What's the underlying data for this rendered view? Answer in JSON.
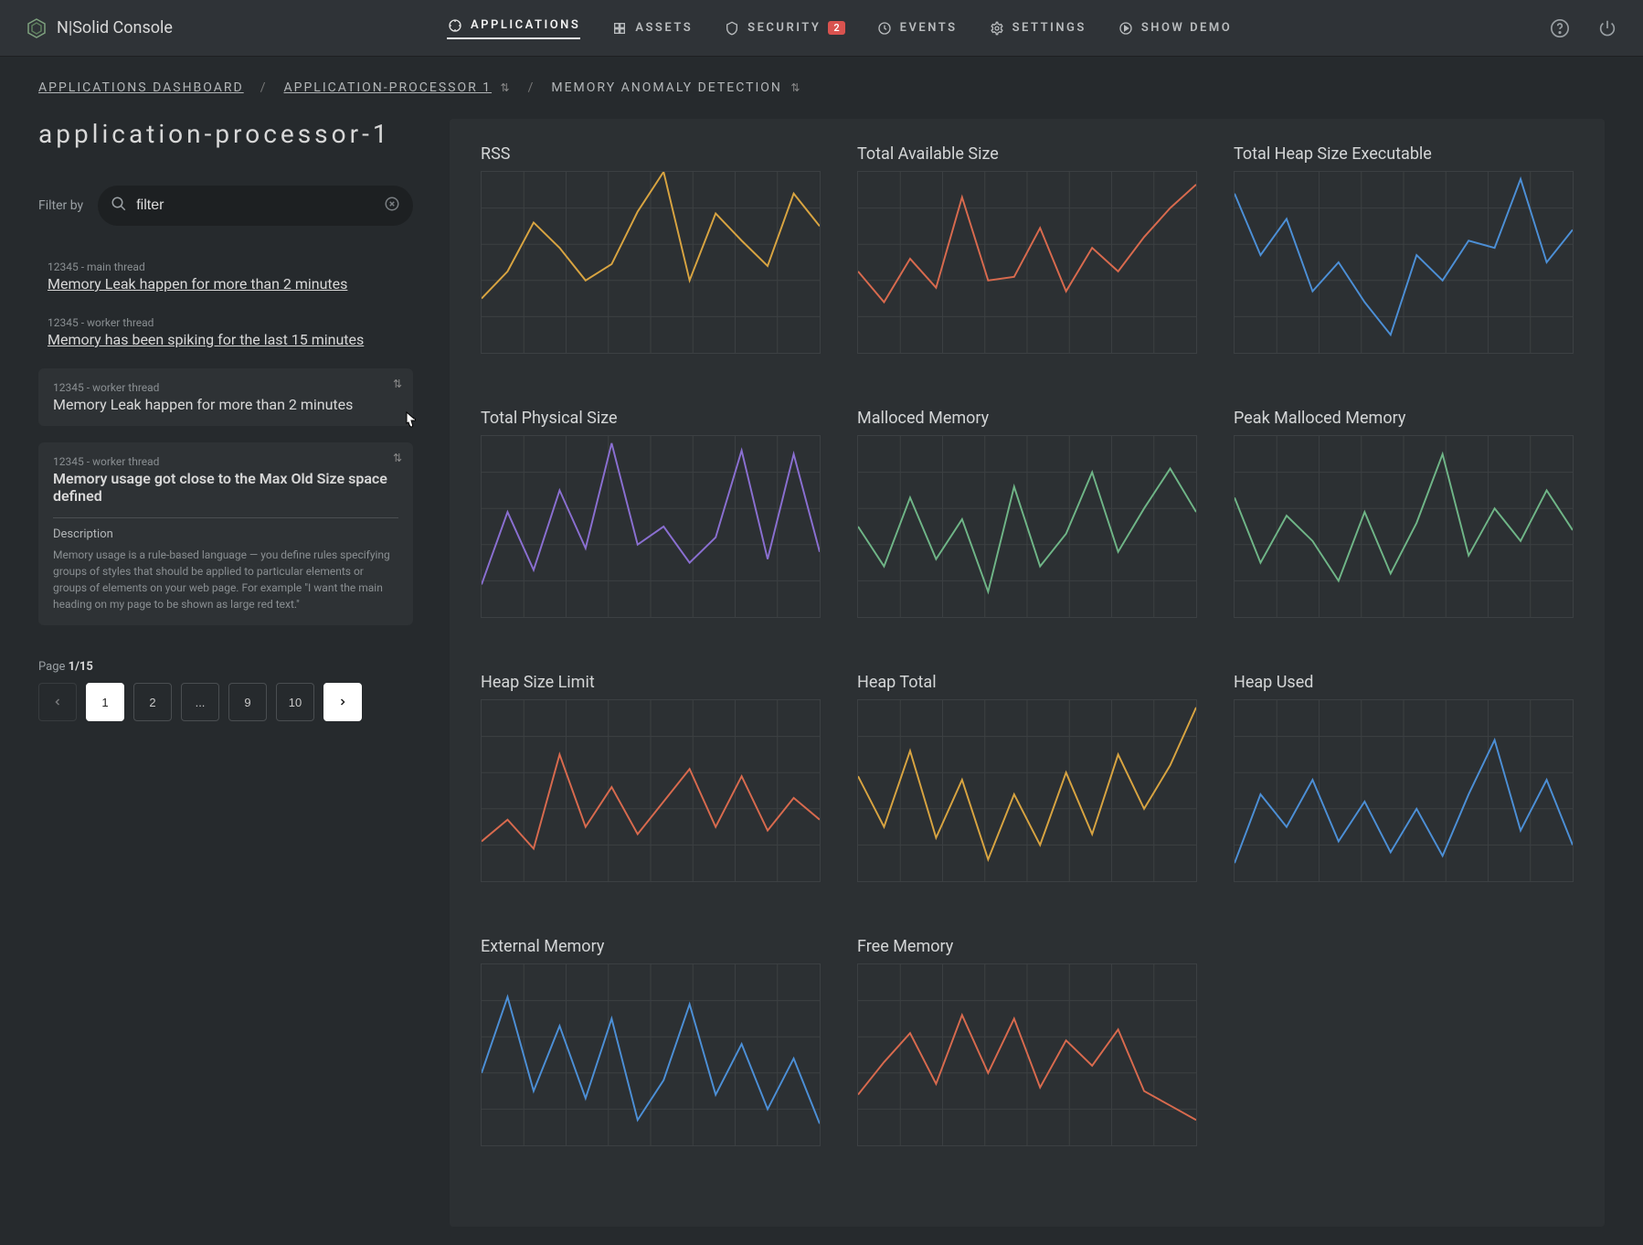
{
  "brand": "N|Solid Console",
  "nav": {
    "applications": "APPLICATIONS",
    "assets": "ASSETS",
    "security": "SECURITY",
    "security_badge": "2",
    "events": "EVENTS",
    "settings": "SETTINGS",
    "show_demo": "SHOW DEMO"
  },
  "breadcrumb": {
    "root": "APPLICATIONS DASHBOARD",
    "app": "APPLICATION-PROCESSOR 1",
    "view": "MEMORY ANOMALY DETECTION"
  },
  "sidebar": {
    "title": "application-processor-1",
    "filter_label": "Filter by",
    "filter_value": "filter",
    "items": [
      {
        "meta": "12345 - main thread",
        "title": "Memory Leak happen for more than 2 minutes"
      },
      {
        "meta": "12345 - worker thread",
        "title": "Memory has been spiking for the last 15 minutes"
      },
      {
        "meta": "12345 - worker thread",
        "title": "Memory Leak happen for more than 2 minutes"
      },
      {
        "meta": "12345 - worker thread",
        "title": "Memory usage got close to the Max Old Size space defined"
      }
    ],
    "desc_label": "Description",
    "desc_text": "Memory usage is a rule-based language — you define rules specifying groups of styles that should be applied to particular elements or groups of elements on your web page. For example \"I want the main heading on my page to be shown as large red text.\"",
    "page_prefix": "Page ",
    "page_value": "1/15",
    "pagination": [
      "1",
      "2",
      "...",
      "9",
      "10"
    ]
  },
  "chart_data": [
    {
      "type": "line",
      "title": "RSS",
      "color": "#d8a441",
      "ylim": [
        0,
        100
      ],
      "values": [
        30,
        45,
        72,
        58,
        40,
        49,
        78,
        100,
        40,
        77,
        62,
        48,
        88,
        70
      ]
    },
    {
      "type": "line",
      "title": "Total Available Size",
      "color": "#d86a4e",
      "ylim": [
        0,
        100
      ],
      "values": [
        45,
        28,
        52,
        36,
        86,
        40,
        42,
        69,
        34,
        58,
        45,
        64,
        80,
        93
      ]
    },
    {
      "type": "line",
      "title": "Total Heap Size Executable",
      "color": "#4c8fd6",
      "ylim": [
        0,
        100
      ],
      "values": [
        88,
        54,
        74,
        34,
        50,
        28,
        10,
        54,
        40,
        62,
        58,
        96,
        50,
        68
      ]
    },
    {
      "type": "line",
      "title": "Total Physical Size",
      "color": "#8a6fd1",
      "ylim": [
        0,
        100
      ],
      "values": [
        18,
        58,
        26,
        70,
        38,
        96,
        40,
        50,
        30,
        44,
        92,
        32,
        90,
        36
      ]
    },
    {
      "type": "line",
      "title": "Malloced Memory",
      "color": "#6fb587",
      "ylim": [
        0,
        100
      ],
      "values": [
        50,
        28,
        66,
        32,
        54,
        14,
        72,
        28,
        46,
        80,
        36,
        60,
        82,
        58
      ]
    },
    {
      "type": "line",
      "title": "Peak Malloced Memory",
      "color": "#6fb587",
      "ylim": [
        0,
        100
      ],
      "values": [
        66,
        30,
        56,
        42,
        20,
        58,
        24,
        52,
        90,
        34,
        60,
        42,
        70,
        48
      ]
    },
    {
      "type": "line",
      "title": "Heap Size Limit",
      "color": "#d86a4e",
      "ylim": [
        0,
        100
      ],
      "values": [
        22,
        34,
        18,
        70,
        30,
        52,
        26,
        44,
        62,
        30,
        58,
        28,
        46,
        34
      ]
    },
    {
      "type": "line",
      "title": "Heap Total",
      "color": "#d8a441",
      "ylim": [
        0,
        100
      ],
      "values": [
        58,
        30,
        72,
        24,
        56,
        12,
        48,
        20,
        60,
        26,
        70,
        40,
        64,
        96
      ]
    },
    {
      "type": "line",
      "title": "Heap Used",
      "color": "#4c8fd6",
      "ylim": [
        0,
        100
      ],
      "values": [
        10,
        48,
        30,
        56,
        22,
        44,
        16,
        40,
        14,
        48,
        78,
        28,
        56,
        20
      ]
    },
    {
      "type": "line",
      "title": "External Memory",
      "color": "#4c8fd6",
      "ylim": [
        0,
        100
      ],
      "values": [
        40,
        82,
        30,
        66,
        26,
        70,
        14,
        36,
        78,
        28,
        56,
        20,
        48,
        12
      ]
    },
    {
      "type": "line",
      "title": "Free Memory",
      "color": "#d86a4e",
      "ylim": [
        0,
        100
      ],
      "values": [
        28,
        46,
        62,
        34,
        72,
        40,
        70,
        32,
        58,
        44,
        64,
        30,
        22,
        14
      ]
    }
  ]
}
